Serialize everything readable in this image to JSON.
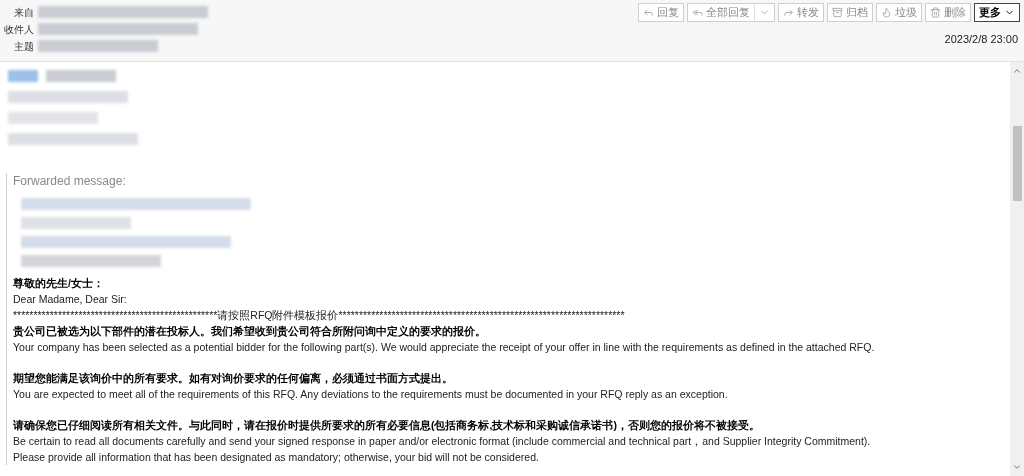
{
  "header": {
    "fields": [
      {
        "label": "来自"
      },
      {
        "label": "收件人"
      },
      {
        "label": "主题"
      }
    ],
    "toolbar": [
      {
        "label": "回复",
        "kind": "action",
        "dropdown": false
      },
      {
        "label": "全部回复",
        "kind": "action",
        "dropdown": true
      },
      {
        "label": "转发",
        "kind": "action",
        "dropdown": false
      },
      {
        "label": "归档",
        "kind": "action",
        "dropdown": false
      },
      {
        "label": "垃圾",
        "kind": "action",
        "dropdown": false
      },
      {
        "label": "删除",
        "kind": "action",
        "dropdown": false
      },
      {
        "label": "更多",
        "kind": "menu",
        "dropdown": true
      }
    ],
    "date": "2023/2/8 23:00"
  },
  "body": {
    "forwarded_label": "Forwarded message:",
    "paragraphs": [
      {
        "lines": [
          {
            "text": "尊敬的先生/女士：",
            "bold": true
          },
          {
            "text": "Dear Madame, Dear Sir:",
            "bold": false
          },
          {
            "text": "**************************************************请按照RFQ附件模板报价**********************************************************************",
            "bold": false
          },
          {
            "text": "贵公司已被选为以下部件的潜在投标人。我们希望收到贵公司符合所附问询中定义的要求的报价。",
            "bold": true
          },
          {
            "text": "Your company has been selected as a potential bidder for the following part(s). We would appreciate the receipt of your offer in line with the requirements as defined in the attached RFQ.",
            "bold": false
          }
        ]
      },
      {
        "lines": [
          {
            "text": "期望您能满足该询价中的所有要求。如有对询价要求的任何偏离，必须通过书面方式提出。",
            "bold": true
          },
          {
            "text": "You are expected to meet all of the requirements of this RFQ. Any deviations to the requirements must be documented in your RFQ reply as an exception.",
            "bold": false
          }
        ]
      },
      {
        "lines": [
          {
            "text": "请确保您已仔细阅读所有相关文件。与此同时，请在报价时提供所要求的所有必要信息(包括商务标,技术标和采购诚信承诺书)，否则您的报价将不被接受。",
            "bold": true
          },
          {
            "text": "Be certain to read all documents carefully and send your signed response in paper and/or electronic format (include commercial and technical part，and Supplier Integrity Commitment).",
            "bold": false
          },
          {
            "text": "Please provide all information that has been designated as mandatory; otherwise, your bid will not be considered.",
            "bold": false
          }
        ]
      }
    ]
  }
}
